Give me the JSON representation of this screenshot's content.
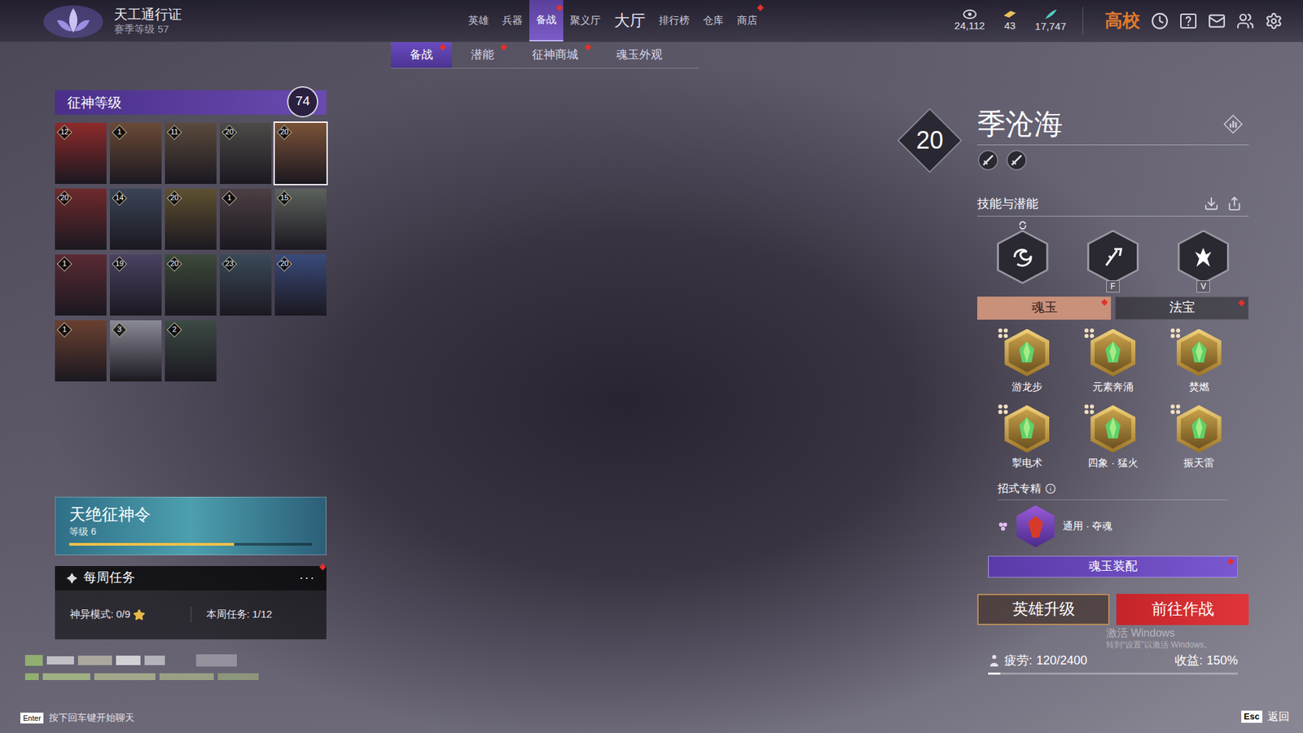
{
  "pass": {
    "title": "天工通行证",
    "season": "赛季等级 57"
  },
  "nav": [
    {
      "label": "英雄",
      "selected": false,
      "dot": false,
      "kind": "normal"
    },
    {
      "label": "兵器",
      "selected": false,
      "dot": false,
      "kind": "normal"
    },
    {
      "label": "备战",
      "selected": true,
      "dot": true,
      "kind": "normal"
    },
    {
      "label": "聚义厅",
      "selected": false,
      "dot": false,
      "kind": "normal"
    },
    {
      "label": "大厅",
      "selected": false,
      "dot": false,
      "kind": "main"
    },
    {
      "label": "排行榜",
      "selected": false,
      "dot": false,
      "kind": "normal"
    },
    {
      "label": "仓库",
      "selected": false,
      "dot": false,
      "kind": "normal"
    },
    {
      "label": "商店",
      "selected": false,
      "dot": true,
      "kind": "normal"
    }
  ],
  "currencies": [
    {
      "value": "24,112"
    },
    {
      "value": "43"
    },
    {
      "value": "17,747"
    }
  ],
  "server": "高校",
  "subtabs": [
    {
      "label": "备战",
      "selected": true,
      "dot": true
    },
    {
      "label": "潜能",
      "selected": false,
      "dot": true
    },
    {
      "label": "征神商城",
      "selected": false,
      "dot": true
    },
    {
      "label": "魂玉外观",
      "selected": false,
      "dot": false
    }
  ],
  "conquest": {
    "title": "征神等级",
    "level": "74"
  },
  "heroes": [
    {
      "level": "12",
      "selected": false,
      "color": "#8e2a2a"
    },
    {
      "level": "1",
      "selected": false,
      "color": "#6b4a36"
    },
    {
      "level": "11",
      "selected": false,
      "color": "#5a4a3c"
    },
    {
      "level": "20",
      "selected": false,
      "color": "#4d4a48"
    },
    {
      "level": "20",
      "selected": true,
      "color": "#7a5238"
    },
    {
      "level": "20",
      "selected": false,
      "color": "#6e2a2c"
    },
    {
      "level": "14",
      "selected": false,
      "color": "#3a4456"
    },
    {
      "level": "20",
      "selected": false,
      "color": "#5e5030"
    },
    {
      "level": "1",
      "selected": false,
      "color": "#4c3f44"
    },
    {
      "level": "15",
      "selected": false,
      "color": "#5c625c"
    },
    {
      "level": "1",
      "selected": false,
      "color": "#5a2a34"
    },
    {
      "level": "19",
      "selected": false,
      "color": "#4a4262"
    },
    {
      "level": "20",
      "selected": false,
      "color": "#3c4a3a"
    },
    {
      "level": "23",
      "selected": false,
      "color": "#3a4a58"
    },
    {
      "level": "20",
      "selected": false,
      "color": "#3a4a7a"
    },
    {
      "level": "1",
      "selected": false,
      "color": "#6a4030"
    },
    {
      "level": "3",
      "selected": false,
      "color": "#8a8a96"
    },
    {
      "level": "2",
      "selected": false,
      "color": "#3c4a44"
    }
  ],
  "battle_pass": {
    "title": "天绝征神令",
    "level_text": "等级 6",
    "level": 0.68
  },
  "weekly": {
    "title": "每周任务",
    "more": "···",
    "dot": true,
    "items": [
      {
        "label": "神异模式:",
        "value": "0/9"
      },
      {
        "label": "本周任务:",
        "value": "1/12"
      }
    ]
  },
  "chat_hint": {
    "key": "Enter",
    "text": "按下回车键开始聊天"
  },
  "hero": {
    "level": "20",
    "name": "季沧海"
  },
  "skills": {
    "title": "技能与潜能",
    "items": [
      {
        "key": null
      },
      {
        "key": "F"
      },
      {
        "key": "V"
      }
    ]
  },
  "loadout_tabs": [
    {
      "label": "魂玉",
      "selected": true,
      "dot": true
    },
    {
      "label": "法宝",
      "selected": false,
      "dot": true
    }
  ],
  "jades": [
    {
      "name": "游龙步"
    },
    {
      "name": "元素奔涌"
    },
    {
      "name": "焚燃"
    },
    {
      "name": "掣电术"
    },
    {
      "name": "四象 · 猛火"
    },
    {
      "name": "振天雷"
    }
  ],
  "mastery": {
    "title": "招式专精",
    "item": "通用 · 夺魂"
  },
  "equip_button": {
    "label": "魂玉装配",
    "dot": true
  },
  "buttons": [
    {
      "label": "英雄升级",
      "kind": "secondary"
    },
    {
      "label": "前往作战",
      "kind": "primary"
    }
  ],
  "fatigue": {
    "label": "疲劳:",
    "reading": "120/2400",
    "level": 0.05
  },
  "income": {
    "label": "收益:",
    "reading": "150%"
  },
  "watermark": [
    "激活 Windows",
    "转到“设置”以激活 Windows。"
  ],
  "back": {
    "key": "Esc",
    "label": "返回"
  }
}
